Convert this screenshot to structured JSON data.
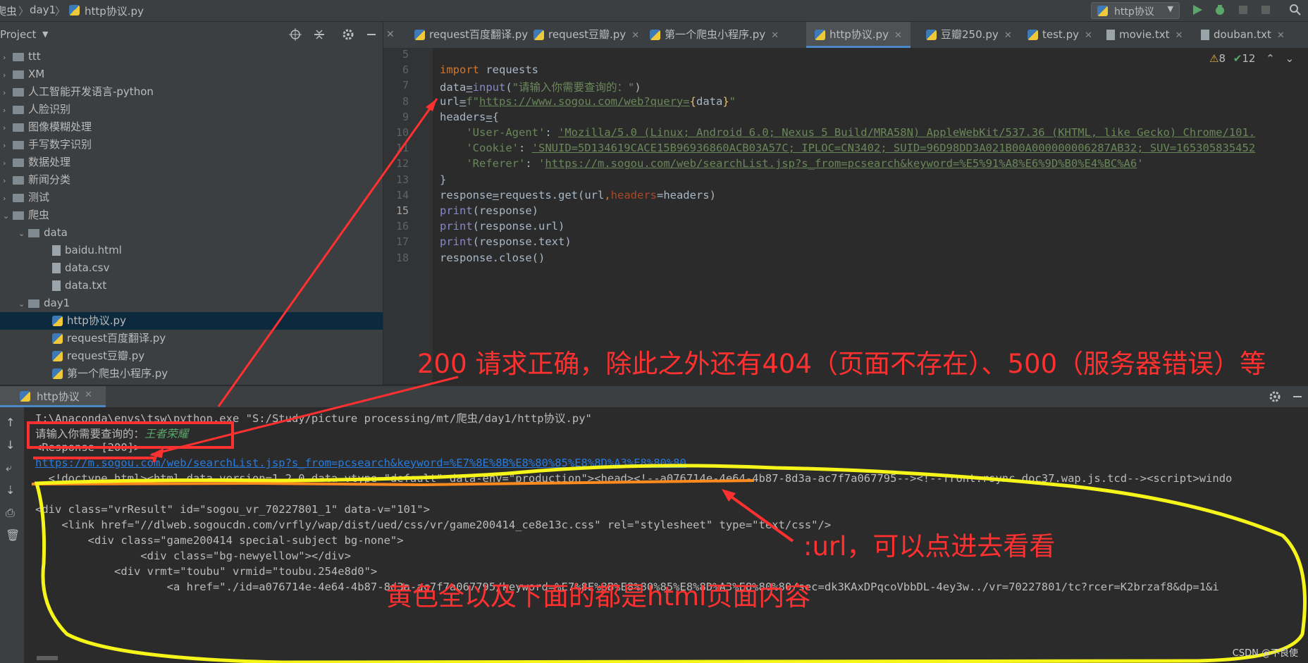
{
  "breadcrumb": [
    "爬虫",
    "day1",
    "http协议.py"
  ],
  "run_config": "http协议",
  "project": {
    "label": "Project"
  },
  "tree": [
    {
      "label": "ttt",
      "type": "folder",
      "depth": 0,
      "arrow": "›"
    },
    {
      "label": "XM",
      "type": "folder",
      "depth": 0,
      "arrow": "›"
    },
    {
      "label": "人工智能开发语言-python",
      "type": "folder",
      "depth": 0,
      "arrow": "›"
    },
    {
      "label": "人脸识别",
      "type": "folder",
      "depth": 0,
      "arrow": "›"
    },
    {
      "label": "图像模糊处理",
      "type": "folder",
      "depth": 0,
      "arrow": "›"
    },
    {
      "label": "手写数字识别",
      "type": "folder",
      "depth": 0,
      "arrow": "›"
    },
    {
      "label": "数据处理",
      "type": "folder",
      "depth": 0,
      "arrow": "›"
    },
    {
      "label": "新闻分类",
      "type": "folder",
      "depth": 0,
      "arrow": "›"
    },
    {
      "label": "测试",
      "type": "folder",
      "depth": 0,
      "arrow": "›"
    },
    {
      "label": "爬虫",
      "type": "folder",
      "depth": 0,
      "arrow": "⌄"
    },
    {
      "label": "data",
      "type": "folder",
      "depth": 1,
      "arrow": "⌄"
    },
    {
      "label": "baidu.html",
      "type": "txt",
      "depth": 2,
      "arrow": ""
    },
    {
      "label": "data.csv",
      "type": "txt",
      "depth": 2,
      "arrow": ""
    },
    {
      "label": "data.txt",
      "type": "txt",
      "depth": 2,
      "arrow": ""
    },
    {
      "label": "day1",
      "type": "folder",
      "depth": 1,
      "arrow": "⌄"
    },
    {
      "label": "http协议.py",
      "type": "py",
      "depth": 2,
      "arrow": "",
      "selected": true
    },
    {
      "label": "request百度翻译.py",
      "type": "py",
      "depth": 2,
      "arrow": ""
    },
    {
      "label": "request豆瓣.py",
      "type": "py",
      "depth": 2,
      "arrow": ""
    },
    {
      "label": "第一个爬虫小程序.py",
      "type": "py",
      "depth": 2,
      "arrow": ""
    }
  ],
  "tabs": [
    {
      "label": "request百度翻译.py",
      "type": "py"
    },
    {
      "label": "request豆瓣.py",
      "type": "py"
    },
    {
      "label": "第一个爬虫小程序.py",
      "type": "py"
    },
    {
      "label": "http协议.py",
      "type": "py",
      "active": true
    },
    {
      "label": "豆瓣250.py",
      "type": "py"
    },
    {
      "label": "test.py",
      "type": "py"
    },
    {
      "label": "movie.txt",
      "type": "txt"
    },
    {
      "label": "douban.txt",
      "type": "txt"
    }
  ],
  "inspections": {
    "warnings": "8",
    "ok": "12"
  },
  "editor": {
    "line_numbers": [
      "5",
      "6",
      "7",
      "8",
      "9",
      "10",
      "11",
      "12",
      "13",
      "14",
      "15",
      "16",
      "17",
      "18"
    ],
    "lines": [
      [],
      [
        {
          "t": "import ",
          "c": "kw"
        },
        {
          "t": "requests",
          "c": ""
        }
      ],
      [
        {
          "t": "data",
          "c": ""
        },
        {
          "t": "=",
          "c": "u"
        },
        {
          "t": "input",
          "c": "fn"
        },
        {
          "t": "(",
          "c": ""
        },
        {
          "t": "\"请输入你需要查询的：\"",
          "c": "str"
        },
        {
          "t": ")",
          "c": ""
        }
      ],
      [
        {
          "t": "url",
          "c": ""
        },
        {
          "t": "=",
          "c": "u"
        },
        {
          "t": "f\"",
          "c": "str"
        },
        {
          "t": "https://www.sogou.com/web?query=",
          "c": "str u"
        },
        {
          "t": "{",
          "c": "brace"
        },
        {
          "t": "data",
          "c": ""
        },
        {
          "t": "}",
          "c": "brace"
        },
        {
          "t": "\"",
          "c": "str"
        }
      ],
      [
        {
          "t": "headers",
          "c": ""
        },
        {
          "t": "=",
          "c": "u"
        },
        {
          "t": "{",
          "c": ""
        }
      ],
      [
        {
          "t": "    'User-Agent'",
          "c": "str"
        },
        {
          "t": ": ",
          "c": ""
        },
        {
          "t": "'Mozilla/5.0 (Linux; Android 6.0; Nexus 5 Build/MRA58N) AppleWebKit/537.36 (KHTML, like Gecko) Chrome/101.",
          "c": "str u"
        }
      ],
      [
        {
          "t": "    'Cookie'",
          "c": "str"
        },
        {
          "t": ": ",
          "c": ""
        },
        {
          "t": "'SNUID=5D134619CACE15B96936860ACB03A57C; IPLOC=CN3402; SUID=96D98DD3A021B00A000000006287AB32; SUV=165305835452",
          "c": "str u"
        }
      ],
      [
        {
          "t": "    'Referer'",
          "c": "str"
        },
        {
          "t": ": ",
          "c": ""
        },
        {
          "t": "'",
          "c": "str"
        },
        {
          "t": "https://m.sogou.com/web/searchList.jsp?s_from=pcsearch&keyword=%E5%91%A8%E6%9D%B0%E4%BC%A6",
          "c": "str u"
        },
        {
          "t": "'",
          "c": "str"
        }
      ],
      [
        {
          "t": "}",
          "c": ""
        }
      ],
      [
        {
          "t": "response",
          "c": ""
        },
        {
          "t": "=",
          "c": "u"
        },
        {
          "t": "requests.get(url",
          "c": ""
        },
        {
          "t": ",",
          "c": "kw"
        },
        {
          "t": "headers",
          "c": "par"
        },
        {
          "t": "=headers)",
          "c": ""
        }
      ],
      [
        {
          "t": "print",
          "c": "fn"
        },
        {
          "t": "(response)",
          "c": ""
        }
      ],
      [
        {
          "t": "print",
          "c": "fn"
        },
        {
          "t": "(response.url)",
          "c": ""
        }
      ],
      [
        {
          "t": "print",
          "c": "fn"
        },
        {
          "t": "(response.text)",
          "c": ""
        }
      ],
      [
        {
          "t": "response.close()",
          "c": ""
        }
      ]
    ]
  },
  "run_tab": "http协议",
  "console": {
    "cmd": "I:\\Anaconda\\envs\\tsw\\python.exe \"S:/Study/picture processing/mt/爬虫/day1/http协议.py\"",
    "prompt": "请输入你需要查询的：",
    "prompt_input": "王者荣耀",
    "response": "<Response [200]>",
    "url": "https://m.sogou.com/web/searchList.jsp?s_from=pcsearch&keyword=%E7%8E%8B%E8%80%85%E8%8D%A3%E8%80%80",
    "html_lines": [
      "  <!doctype html><html data-version=1.2.0 data-vtype=\"default\" data-env=\"production\"><head><!--a076714e-4e64-4b87-8d3a-ac7f7a067795--><!--front:rsync.doc37.wap.js.tcd--><script>windo",
      "",
      "<div class=\"vrResult\" id=\"sogou_vr_70227801_1\" data-v=\"101\">",
      "    <link href=\"//dlweb.sogoucdn.com/vrfly/wap/dist/ued/css/vr/game200414_ce8e13c.css\" rel=\"stylesheet\" type=\"text/css\"/>",
      "        <div class=\"game200414 special-subject bg-none\">",
      "                <div class=\"bg-newyellow\"></div>",
      "            <div vrmt=\"toubu\" vrmid=\"toubu.254e8d0\">",
      "                    <a href=\"./id=a076714e-4e64-4b87-8d3a-ac7f7a067795/keyword=%E7%8E%8B%E8%80%85%E8%8D%A3%E8%80%80/sec=dk3KAxDPqcoVbbDL-4ey3w../vr=70227801/tc?rcer=K2brzaf8&dp=1&i"
    ]
  },
  "annotations": {
    "status": "200 请求正确，除此之外还有404（页面不存在）、500（服务器错误）等",
    "url_note": ":url，可以点进去看看",
    "html_note": "黄色全以及下面的都是html页面内容"
  },
  "watermark": "CSDN @不良使",
  "colors": {
    "annotation": "#ff3030",
    "yellow": "#f5f51a",
    "orange": "#ff8a1e",
    "accent": "#4a88c7"
  }
}
